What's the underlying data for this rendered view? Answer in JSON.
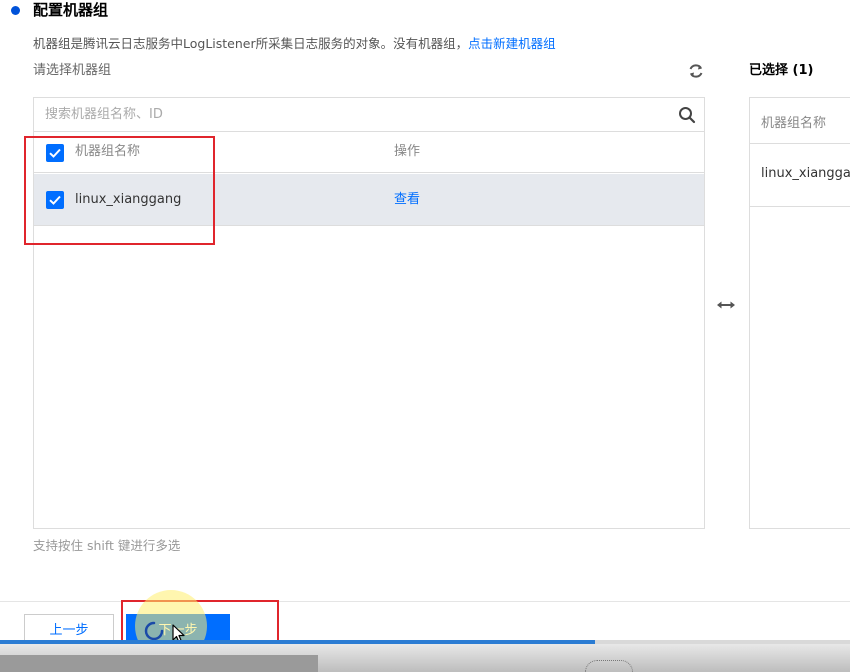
{
  "section": {
    "title": "配置机器组",
    "description": "机器组是腾讯云日志服务中LogListener所采集日志服务的对象。没有机器组，",
    "create_link": "点击新建机器组"
  },
  "left_panel": {
    "label": "请选择机器组",
    "search_placeholder": "搜索机器组名称、ID",
    "columns": {
      "name": "机器组名称",
      "action": "操作"
    },
    "rows": [
      {
        "name": "linux_xianggang",
        "action": "查看",
        "checked": true
      }
    ],
    "hint": "支持按住 shift 键进行多选"
  },
  "right_panel": {
    "title": "已选择 (1)",
    "column": "机器组名称",
    "items": [
      "linux_xianggang"
    ]
  },
  "footer": {
    "prev_label": "上一步",
    "next_label": "下一步"
  },
  "progress": {
    "value": 0.7
  },
  "colors": {
    "accent": "#006eff",
    "highlight": "#e0252c",
    "selected_row": "#e6e9ee"
  }
}
